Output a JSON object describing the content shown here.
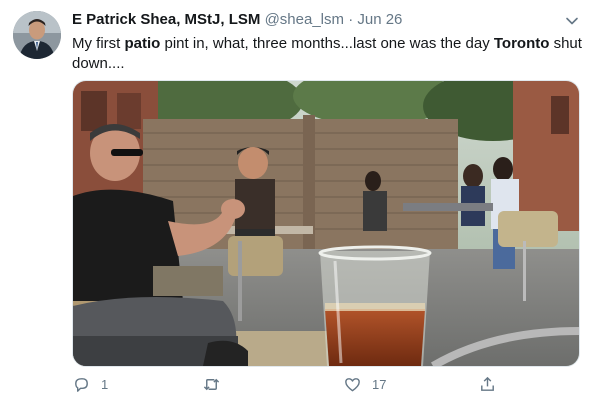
{
  "tweet": {
    "author_name": "E Patrick Shea, MStJ, LSM",
    "handle": "@shea_lsm",
    "separator": "·",
    "date": "Jun 26",
    "text_parts": [
      "My first ",
      "patio",
      " pint in, what, three months...last one was the day ",
      "Toronto",
      " shut down...."
    ]
  },
  "actions": {
    "reply_count": "1",
    "retweet_count": "",
    "like_count": "17"
  },
  "icons": {
    "avatar": "avatar",
    "more": "chevron-down-icon",
    "reply": "reply-icon",
    "retweet": "retweet-icon",
    "like": "heart-icon",
    "share": "share-icon"
  },
  "colors": {
    "muted": "#657786",
    "text": "#14171a",
    "border": "#e1e8ed"
  }
}
